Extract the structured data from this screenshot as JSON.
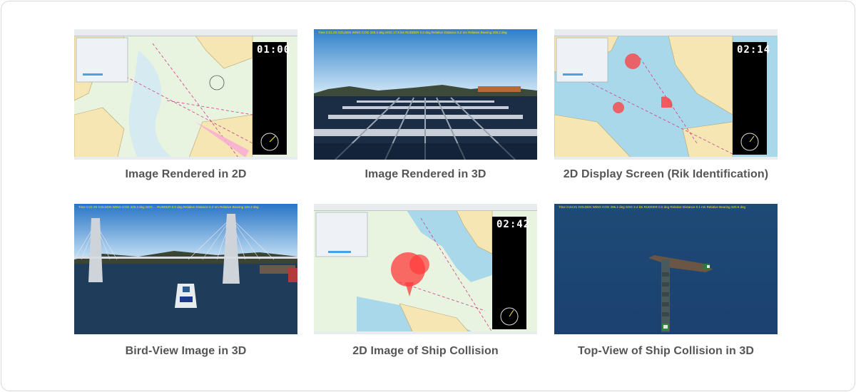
{
  "captions": [
    "Image Rendered in 2D",
    "Image Rendered in 3D",
    "2D Display Screen (Rik Identification)",
    "Bird-View Image in 3D",
    "2D Image of Ship Collision",
    "Top-View of Ship Collision in 3D"
  ],
  "screens": {
    "s1": {
      "clock": "01:00"
    },
    "s3": {
      "clock": "02:14"
    },
    "s5": {
      "clock": "02:42"
    },
    "s2": {
      "hud": "Time  0:21:20   GOLDEN WING   COG  328.3 deg   SOG  17.9 kts   RUDDER  0.0 deg   Relative Distance  5.2 nm   Relative Bearing  328.3 deg"
    },
    "s4": {
      "hud": "Time  0:21:20   GOLDEN WING   COG  328.3 deg   SOG  ...   RUDDER  0.0 deg   Relative Distance  5.2 nm   Relative Bearing  328.3 deg"
    },
    "s6": {
      "hud": "Time  0:24:21   GOLDEN WING   COG  296.2 deg   SOG  3.4 kts   RUDDER  0.0 deg   Relative Distance  0.1 nm   Relative Bearing  320.9 deg"
    }
  },
  "colors": {
    "sea": "#a8d8ea",
    "land": "#f5e6b4",
    "sky": "#4e9fd6",
    "ocean_top": "#1f4d7a",
    "risk": "#ff3b3b"
  }
}
